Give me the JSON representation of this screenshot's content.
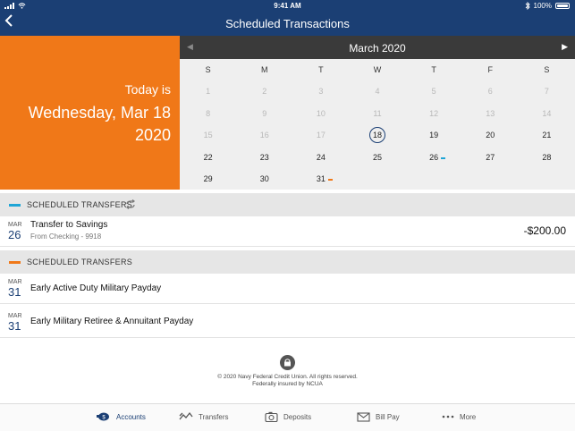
{
  "status_bar": {
    "time": "9:41 AM",
    "battery": "100%"
  },
  "header": {
    "title": "Scheduled Transactions"
  },
  "today": {
    "line1": "Today is",
    "line2": "Wednesday, Mar 18",
    "line3": "2020"
  },
  "calendar": {
    "month_label": "March 2020",
    "prev_arrow": "◀",
    "next_arrow": "▶",
    "weekdays": [
      "S",
      "M",
      "T",
      "W",
      "T",
      "F",
      "S"
    ],
    "days": [
      "1",
      "2",
      "3",
      "4",
      "5",
      "6",
      "7",
      "8",
      "9",
      "10",
      "11",
      "12",
      "13",
      "14",
      "15",
      "16",
      "17",
      "18",
      "19",
      "20",
      "21",
      "22",
      "23",
      "24",
      "25",
      "26",
      "27",
      "28",
      "29",
      "30",
      "31"
    ],
    "today_day": 18,
    "marked": {
      "26": "#1fa5d6",
      "31": "#f07818"
    }
  },
  "section_transfers": {
    "label": "SCHEDULED TRANSFERS",
    "color": "#1fa5d6"
  },
  "transfer_item": {
    "month": "MAR",
    "day": "26",
    "name": "Transfer to Savings",
    "sub": "From Checking - 9918",
    "amount": "-$200.00"
  },
  "section_payday": {
    "label": "SCHEDULED TRANSFERS",
    "color": "#f07818"
  },
  "payday_items": [
    {
      "month": "MAR",
      "day": "31",
      "name": "Early Active Duty Military Payday"
    },
    {
      "month": "MAR",
      "day": "31",
      "name": "Early Military Retiree & Annuitant Payday"
    }
  ],
  "footer": {
    "line1": "© 2020 Navy Federal Credit Union. All rights reserved.",
    "line2": "Federally insured by NCUA"
  },
  "tabs": {
    "accounts": "Accounts",
    "accounts_badge": "$",
    "transfers": "Transfers",
    "deposits": "Deposits",
    "billpay": "Bill Pay",
    "more": "More"
  },
  "colors": {
    "navy": "#1b3f74",
    "orange": "#f07818",
    "blue": "#1fa5d6"
  }
}
